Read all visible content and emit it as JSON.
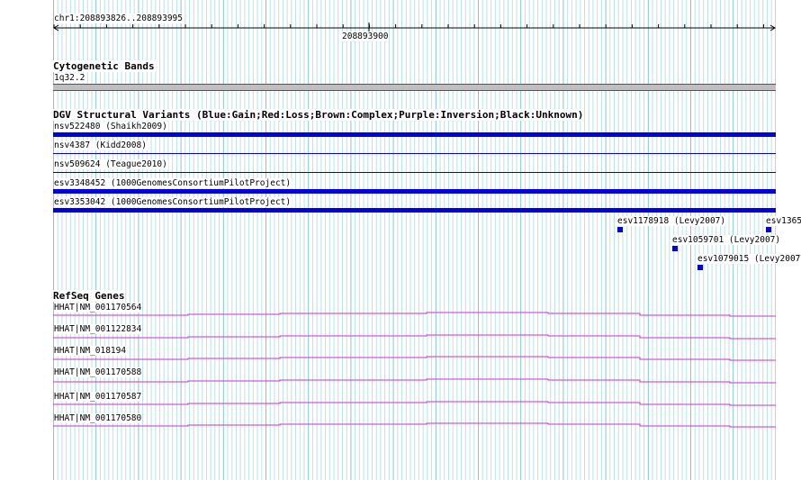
{
  "ruler": {
    "location": "chr1:208893826..208893995",
    "tick_label": "208893900"
  },
  "cytoband_track": {
    "title": "Cytogenetic Bands",
    "band_label": "1q32.2"
  },
  "dgv_track": {
    "title": "DGV Structural Variants (Blue:Gain;Red:Loss;Brown:Complex;Purple:Inversion;Black:Unknown)",
    "colors": {
      "gain": "#0000dd"
    },
    "full_span_items": [
      {
        "label": "nsv522480 (Shaikh2009)"
      },
      {
        "label": "nsv4387 (Kidd2008)"
      },
      {
        "label": "nsv509624 (Teague2010)"
      },
      {
        "label": "esv3348452 (1000GenomesConsortiumPilotProject)"
      },
      {
        "label": "esv3353042 (1000GenomesConsortiumPilotProject)"
      }
    ],
    "point_items": [
      {
        "label": "esv1178918 (Levy2007)"
      },
      {
        "label": "esv1365"
      },
      {
        "label": "esv1059701 (Levy2007)"
      },
      {
        "label": "esv1079015 (Levy2007"
      }
    ]
  },
  "refseq_track": {
    "title": "RefSeq Genes",
    "color": "#cc33cc",
    "genes": [
      {
        "label": "HHAT|NM_001170564"
      },
      {
        "label": "HHAT|NM_001122834"
      },
      {
        "label": "HHAT|NM_018194"
      },
      {
        "label": "HHAT|NM_001170588"
      },
      {
        "label": "HHAT|NM_001170587"
      },
      {
        "label": "HHAT|NM_001170580"
      }
    ]
  }
}
